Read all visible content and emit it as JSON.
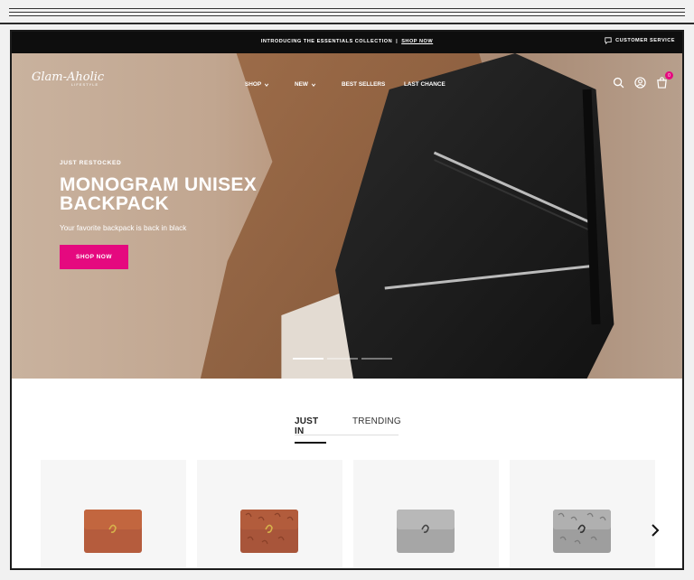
{
  "announcement": {
    "message": "INTRODUCING THE ESSENTIALS COLLECTION",
    "separator": "|",
    "link": "SHOP NOW",
    "customer_service": "CUSTOMER SERVICE"
  },
  "logo": {
    "main": "Glam-Aholic",
    "sub": "LIFESTYLE"
  },
  "nav": {
    "shop": "SHOP",
    "new": "NEW",
    "best_sellers": "BEST SELLERS",
    "last_chance": "LAST CHANCE"
  },
  "header": {
    "cart_count": "0"
  },
  "hero": {
    "eyebrow": "JUST RESTOCKED",
    "title": "MONOGRAM UNISEX BACKPACK",
    "subtitle": "Your favorite backpack is back in black",
    "cta": "SHOP NOW"
  },
  "tabs": {
    "active": "JUST IN",
    "inactive": "TRENDING"
  },
  "colors": {
    "accent": "#e5097f",
    "wallet_brown": "#b05a3c",
    "wallet_silver": "#a9a9a9"
  },
  "icons": {
    "search": "search-icon",
    "account": "account-icon",
    "cart": "cart-icon",
    "chat": "chat-icon",
    "next": "chevron-right-icon"
  }
}
